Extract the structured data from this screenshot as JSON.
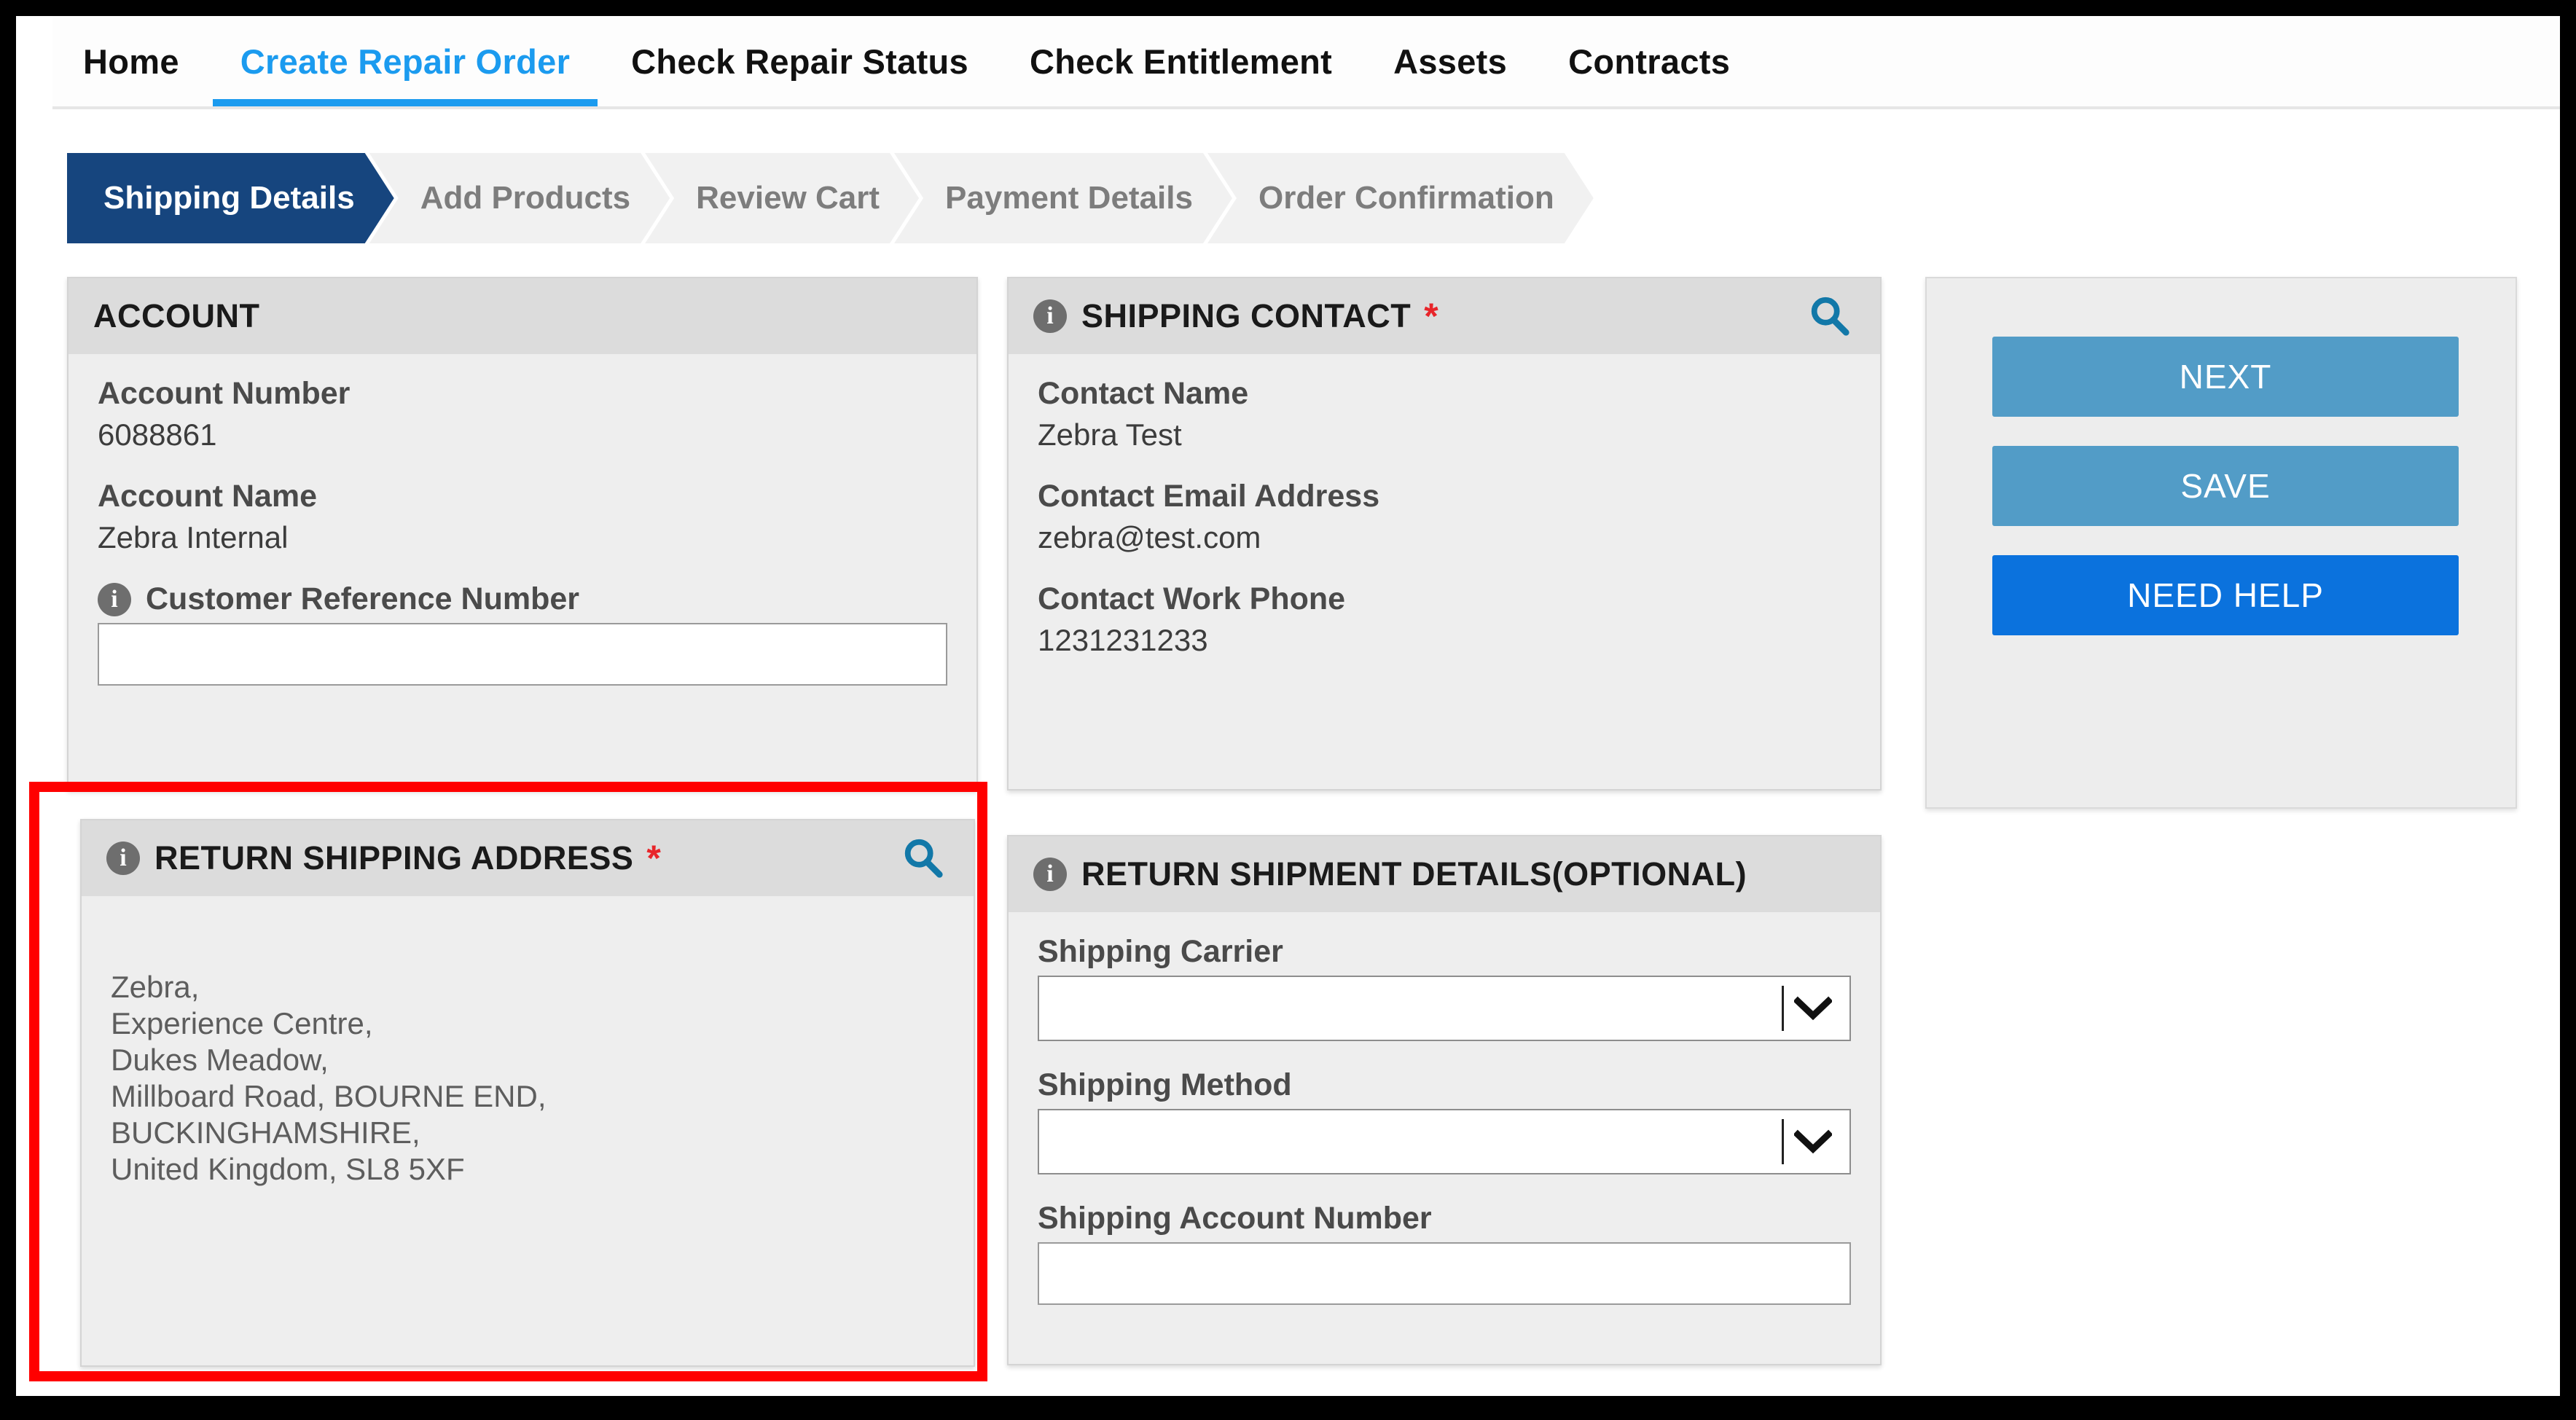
{
  "nav": {
    "items": [
      {
        "label": "Home",
        "active": false
      },
      {
        "label": "Create Repair Order",
        "active": true
      },
      {
        "label": "Check Repair Status",
        "active": false
      },
      {
        "label": "Check Entitlement",
        "active": false
      },
      {
        "label": "Assets",
        "active": false
      },
      {
        "label": "Contracts",
        "active": false
      }
    ]
  },
  "steps": [
    {
      "label": "Shipping Details",
      "active": true
    },
    {
      "label": "Add Products",
      "active": false
    },
    {
      "label": "Review Cart",
      "active": false
    },
    {
      "label": "Payment Details",
      "active": false
    },
    {
      "label": "Order Confirmation",
      "active": false
    }
  ],
  "account": {
    "title": "ACCOUNT",
    "account_number_label": "Account Number",
    "account_number_value": "6088861",
    "account_name_label": "Account Name",
    "account_name_value": "Zebra Internal",
    "customer_ref_label": "Customer Reference Number",
    "customer_ref_value": "",
    "customer_ref_placeholder": ""
  },
  "shipping_contact": {
    "title": "SHIPPING CONTACT",
    "required_marker": "*",
    "contact_name_label": "Contact Name",
    "contact_name_value": "Zebra Test",
    "contact_email_label": "Contact Email Address",
    "contact_email_value": "zebra@test.com",
    "contact_phone_label": "Contact Work Phone",
    "contact_phone_value": "1231231233"
  },
  "return_shipping_address": {
    "title": "RETURN SHIPPING ADDRESS",
    "required_marker": "*",
    "address": "Zebra,\nExperience Centre,\nDukes Meadow,\nMillboard Road, BOURNE END,\nBUCKINGHAMSHIRE,\nUnited Kingdom, SL8 5XF"
  },
  "return_shipment_details": {
    "title": "RETURN SHIPMENT DETAILS(OPTIONAL)",
    "shipping_carrier_label": "Shipping Carrier",
    "shipping_carrier_value": "",
    "shipping_method_label": "Shipping Method",
    "shipping_method_value": "",
    "shipping_account_number_label": "Shipping Account Number",
    "shipping_account_number_value": "",
    "shipping_account_number_placeholder": ""
  },
  "actions": {
    "next_label": "NEXT",
    "save_label": "SAVE",
    "help_label": "NEED HELP"
  },
  "colors": {
    "active_step": "#16457e",
    "active_nav": "#1b9bef",
    "required_star": "#e8252a",
    "search_icon": "#1278a8",
    "primary_button": "#529cc7",
    "help_button": "#0b72dd",
    "highlight_rect": "#ff0000"
  }
}
